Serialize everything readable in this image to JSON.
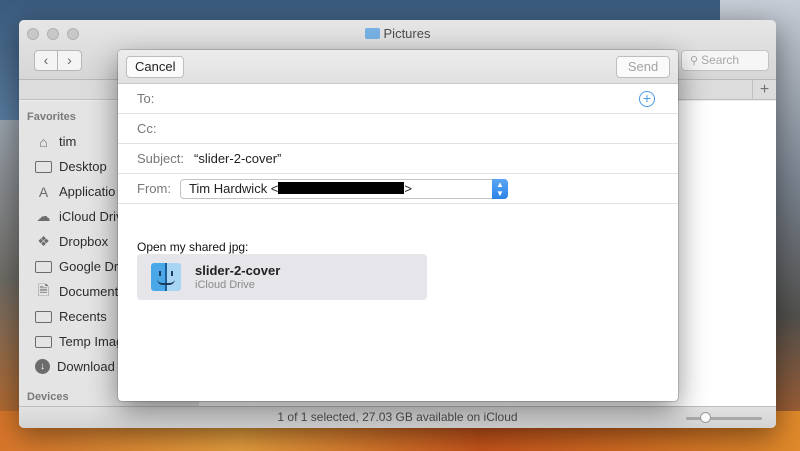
{
  "finder": {
    "title": "Pictures",
    "search_placeholder": "Search",
    "nav_back": "‹",
    "nav_forward": "›",
    "tab_add": "+",
    "sidebar": {
      "favorites_label": "Favorites",
      "items": [
        {
          "label": "tim",
          "icon": "home-icon"
        },
        {
          "label": "Desktop",
          "icon": "desktop-icon"
        },
        {
          "label": "Applicatio",
          "icon": "applications-icon"
        },
        {
          "label": "iCloud Driv",
          "icon": "cloud-icon"
        },
        {
          "label": "Dropbox",
          "icon": "dropbox-icon"
        },
        {
          "label": "Google Dri",
          "icon": "folder-icon"
        },
        {
          "label": "Document",
          "icon": "documents-icon"
        },
        {
          "label": "Recents",
          "icon": "recents-icon"
        },
        {
          "label": "Temp Imag",
          "icon": "folder-icon"
        },
        {
          "label": "Download",
          "icon": "downloads-icon"
        }
      ],
      "devices_label": "Devices"
    },
    "status_text": "1 of 1 selected, 27.03 GB available on iCloud",
    "zoom_level": 0.25
  },
  "compose": {
    "cancel_label": "Cancel",
    "send_label": "Send",
    "to_label": "To:",
    "cc_label": "Cc:",
    "subject_label": "Subject:",
    "subject_value": "“slider-2-cover”",
    "from_label": "From:",
    "from_name": "Tim Hardwick <",
    "from_suffix": ">",
    "shared_label": "Open my shared jpg:",
    "attachment": {
      "name": "slider-2-cover",
      "location": "iCloud Drive",
      "icon": "finder-icon"
    },
    "accent_color": "#2c83e6"
  }
}
